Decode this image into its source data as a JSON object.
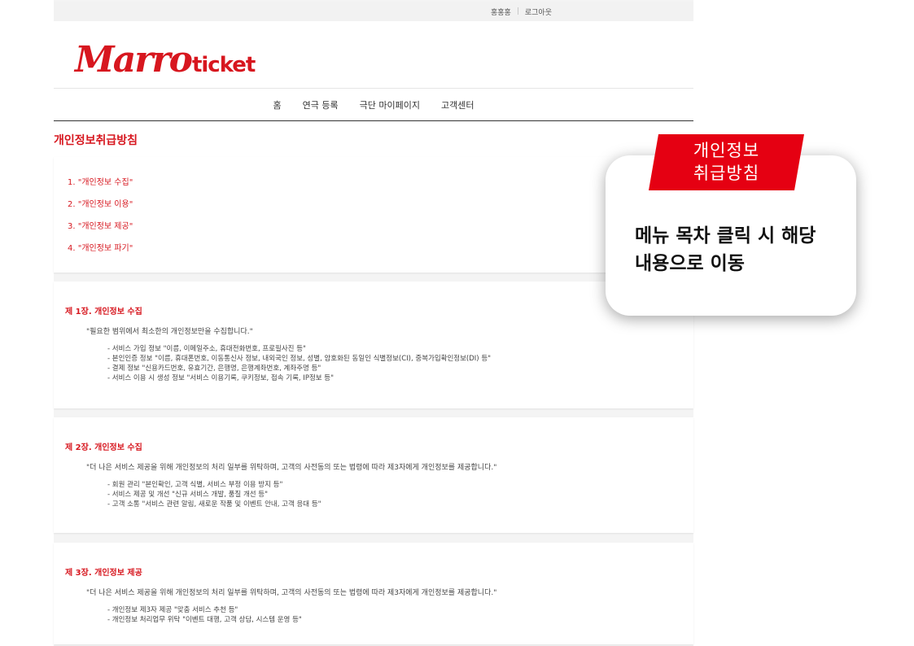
{
  "topbar": {
    "user_name": "홍홍홍",
    "logout": "로그아웃"
  },
  "brand": {
    "logo_script": "Marro",
    "logo_word": "ticket",
    "color": "#d7171f"
  },
  "nav": {
    "items": [
      "홈",
      "연극 등록",
      "극단 마이페이지",
      "고객센터"
    ]
  },
  "page_title": "개인정보취급방침",
  "toc": {
    "items": [
      "1. \"개인정보 수집\"",
      "2. \"개인정보 이용\"",
      "3. \"개인정보 제공\"",
      "4. \"개인정보 파기\""
    ]
  },
  "sections": [
    {
      "title": "제 1장. 개인정보 수집",
      "intro": "\"필요한 범위에서 최소한의 개인정보만을 수집합니다.\"",
      "items": [
        "- 서비스 가입 정보 \"이름, 이메일주소, 휴대전화번호, 프로필사진 등\"",
        "- 본인인증 정보 \"이름, 휴대폰번호, 이동통신사 정보, 내외국인 정보, 성별, 암호화된 동일인 식별정보(CI), 중복가입확인정보(DI) 등\"",
        "- 결제 정보 \"신용카드번호, 유효기간, 은행명, 은행계좌번호, 계좌주명 등\"",
        "- 서비스 이용 시 생성 정보 \"서비스 이용기록, 쿠키정보, 접속 기록, IP정보 등\""
      ]
    },
    {
      "title": "제 2장. 개인정보 수집",
      "intro": "\"더 나은 서비스 제공을 위해 개인정보의 처리 일부를 위탁하며, 고객의 사전동의 또는 법령에 따라 제3자에게 개인정보를 제공합니다.\"",
      "items": [
        "- 회원 관리 \"본인확인, 고객 식별, 서비스 부정 이용 방지 등\"",
        "- 서비스 제공 및 개선 \"신규 서비스 개발, 품질 개선 등\"",
        "- 고객 소통 \"서비스 관련 알림, 새로운 작품 및 이벤트 안내, 고객 응대 등\""
      ]
    },
    {
      "title": "제 3장. 개인정보 제공",
      "intro": "\"더 나은 서비스 제공을 위해 개인정보의 처리 일부를 위탁하며, 고객의 사전동의 또는 법령에 따라 제3자에게 개인정보를 제공합니다.\"",
      "items": [
        "- 개인정보 제3자 제공 \"맞춤 서비스 추천 등\"",
        "- 개인정보 처리업무 위탁 \"이벤트 대행, 고객 상담, 시스템 운영 등\""
      ]
    }
  ],
  "callout": {
    "banner_line1": "개인정보",
    "banner_line2": "취급방침",
    "text_line1": "메뉴 목차 클릭 시 해당",
    "text_line2": "내용으로 이동",
    "banner_color": "#e50012"
  }
}
